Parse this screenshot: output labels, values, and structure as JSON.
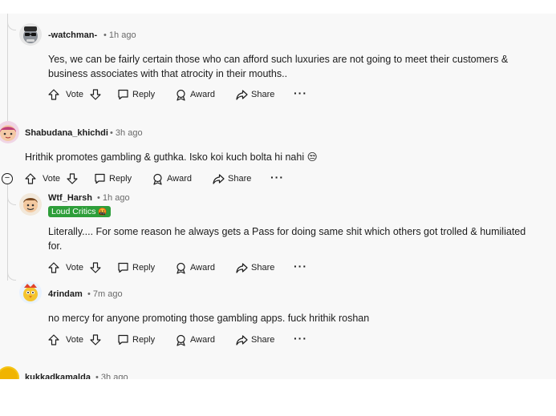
{
  "comments": [
    {
      "author": "-watchman-",
      "time": "1h ago",
      "body": "Yes, we can be fairly certain those who can afford such luxuries are not going to meet their customers & business associates with that atrocity in their mouths..",
      "avatar": "sunglasses-avatar-icon"
    },
    {
      "author": "Shabudana_khichdi",
      "time": "3h ago",
      "body": "Hrithik promotes gambling & guthka. Isko koi kuch bolta hi nahi 😒",
      "avatar": "girl-avatar-icon"
    },
    {
      "author": "Wtf_Harsh",
      "time": "1h ago",
      "flair": "Loud Critics",
      "body": "Literally.... For some reason he always gets a Pass for doing same shit which others got trolled & humiliated for.",
      "avatar": "face-avatar-icon"
    },
    {
      "author": "4rindam",
      "time": "7m ago",
      "body": "no mercy for anyone promoting those gambling apps. fuck hrithik roshan",
      "avatar": "bird-avatar-icon"
    },
    {
      "author": "kukkadkamalda",
      "time": "3h ago",
      "avatar": "yellow-avatar-icon"
    }
  ],
  "actions": {
    "vote": "Vote",
    "reply": "Reply",
    "award": "Award",
    "share": "Share",
    "more": "···"
  },
  "separator": "•",
  "collapse_symbol": "−",
  "colors": {
    "flair_bg": "#2e9e3a",
    "panel_bg": "#f8f8f8"
  }
}
